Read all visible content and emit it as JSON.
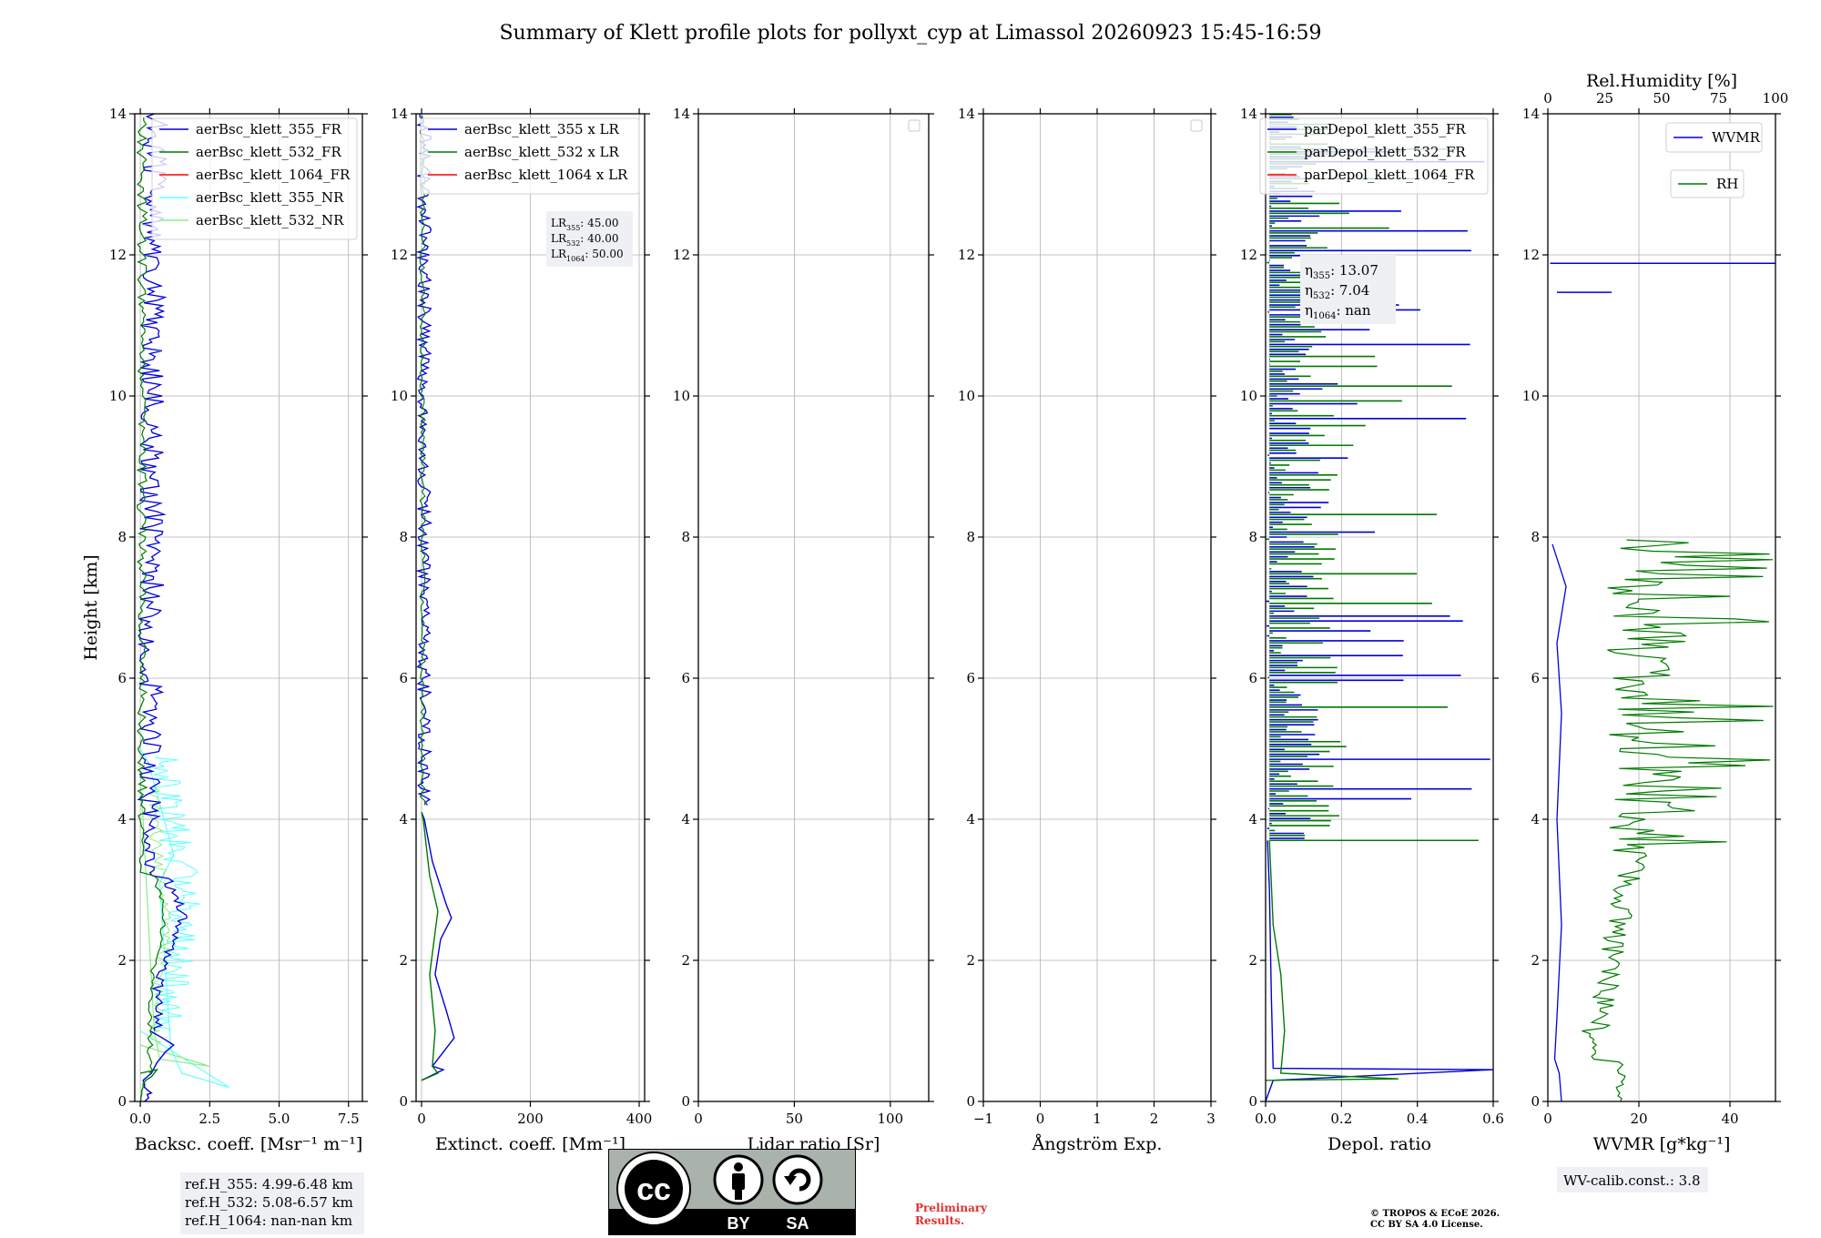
{
  "title": "Summary of Klett profile plots for pollyxt_cyp at Limassol 20260923 15:45-16:59",
  "colors": {
    "b355": "#0000dd",
    "g532": "#007a00",
    "r1064": "#ff0000",
    "c355nr": "#66ffff",
    "lg532nr": "#88ee88",
    "grid": "#b0b0b0"
  },
  "chart_data": [
    {
      "type": "line",
      "id": "bsc",
      "xlabel": "Backsc. coeff. [Msr⁻¹ m⁻¹]",
      "ylabel": "Height [km]",
      "xlim": [
        -0.2,
        8.0
      ],
      "ylim": [
        0,
        14
      ],
      "xticks": [
        0,
        2.5,
        5.0,
        7.5
      ],
      "xtick_labels": [
        "0.0",
        "2.5",
        "5.0",
        "7.5"
      ],
      "yticks": [
        0,
        2,
        4,
        6,
        8,
        10,
        12,
        14
      ],
      "grid": true,
      "legend_position": "top-right",
      "series": [
        {
          "name": "aerBsc_klett_355_FR",
          "color": "b355",
          "profile": [
            [
              0.35,
              1.0
            ],
            [
              0.8,
              0.9
            ],
            [
              1.2,
              0.8
            ],
            [
              0.9,
              0.7
            ],
            [
              0.6,
              0.55
            ],
            [
              0.4,
              0.4
            ],
            [
              0.25,
              0.35
            ],
            [
              0.1,
              0.3
            ],
            [
              0.15,
              0.25
            ],
            [
              0.15,
              0.2
            ],
            [
              0.3,
              0.15
            ],
            [
              0.4,
              0.12
            ],
            [
              0.25,
              0.1
            ],
            [
              0.3,
              0.05
            ],
            [
              0.15,
              0.0
            ]
          ]
        },
        {
          "name": "aerBsc_klett_532_FR",
          "color": "g532",
          "profile": [
            [
              0.0,
              0.4
            ],
            [
              0.6,
              0.45
            ],
            [
              0.4,
              0.35
            ],
            [
              0.2,
              0.3
            ],
            [
              0.1,
              0.25
            ],
            [
              0.1,
              0.2
            ],
            [
              0.05,
              0.15
            ],
            [
              0.05,
              0.1
            ],
            [
              0.02,
              0.05
            ],
            [
              0.02,
              0.0
            ]
          ]
        },
        {
          "name": "aerBsc_klett_1064_FR",
          "color": "r1064",
          "profile": []
        },
        {
          "name": "aerBsc_klett_355_NR",
          "color": "c355nr",
          "profile": [
            [
              0.0,
              1.0
            ],
            [
              3.2,
              0.2
            ],
            [
              1.5,
              0.4
            ],
            [
              1.1,
              0.75
            ],
            [
              0.7,
              3.1
            ],
            [
              1.2,
              3.5
            ],
            [
              0.3,
              4.8
            ],
            [
              0.0,
              5.0
            ]
          ]
        },
        {
          "name": "aerBsc_klett_532_NR",
          "color": "lg532nr",
          "profile": [
            [
              0.0,
              0.8
            ],
            [
              2.5,
              0.5
            ],
            [
              0.7,
              0.6
            ],
            [
              0.5,
              1.0
            ],
            [
              0.3,
              2.5
            ],
            [
              0.1,
              4.0
            ],
            [
              0.0,
              4.5
            ]
          ]
        }
      ],
      "annotation": [
        "ref.H_355: 4.99-6.48 km",
        "ref.H_532: 5.08-6.57 km",
        "ref.H_1064: nan-nan km"
      ]
    },
    {
      "type": "line",
      "id": "ext",
      "xlabel": "Extinct. coeff. [Mm⁻¹]",
      "xlim": [
        -10,
        410
      ],
      "ylim": [
        0,
        14
      ],
      "xticks": [
        0,
        200,
        400
      ],
      "xtick_labels": [
        "0",
        "200",
        "400"
      ],
      "yticks": [
        0,
        2,
        4,
        6,
        8,
        10,
        12,
        14
      ],
      "grid": true,
      "legend_position": "top-right",
      "series": [
        {
          "name": "aerBsc_klett_355 x LR",
          "color": "b355"
        },
        {
          "name": "aerBsc_klett_532 x LR",
          "color": "g532"
        },
        {
          "name": "aerBsc_klett_1064 x LR",
          "color": "r1064"
        }
      ],
      "annotation": [
        {
          "sym": "LR",
          "sub": "355",
          "val": ": 45.00"
        },
        {
          "sym": "LR",
          "sub": "532",
          "val": ": 40.00"
        },
        {
          "sym": "LR",
          "sub": "1064",
          "val": ": 50.00"
        }
      ]
    },
    {
      "type": "line",
      "id": "lr",
      "xlabel": "Lidar ratio [Sr]",
      "xlim": [
        0,
        120
      ],
      "ylim": [
        0,
        14
      ],
      "xticks": [
        0,
        50,
        100
      ],
      "xtick_labels": [
        "0",
        "50",
        "100"
      ],
      "yticks": [
        0,
        2,
        4,
        6,
        8,
        10,
        12,
        14
      ],
      "grid": true,
      "legend_position": "top-right",
      "series": []
    },
    {
      "type": "line",
      "id": "ae",
      "xlabel": "Ångström Exp.",
      "xlim": [
        -1,
        3
      ],
      "ylim": [
        0,
        14
      ],
      "xticks": [
        -1,
        0,
        1,
        2,
        3
      ],
      "xtick_labels": [
        "−1",
        "0",
        "1",
        "2",
        "3"
      ],
      "yticks": [
        0,
        2,
        4,
        6,
        8,
        10,
        12,
        14
      ],
      "grid": true,
      "legend_position": "top-right",
      "series": []
    },
    {
      "type": "line",
      "id": "dep",
      "xlabel": "Depol. ratio",
      "xlim": [
        0,
        0.6
      ],
      "ylim": [
        0,
        14
      ],
      "xticks": [
        0,
        0.2,
        0.4,
        0.6
      ],
      "xtick_labels": [
        "0.0",
        "0.2",
        "0.4",
        "0.6"
      ],
      "yticks": [
        0,
        2,
        4,
        6,
        8,
        10,
        12,
        14
      ],
      "grid": true,
      "legend_position": "top-right",
      "series": [
        {
          "name": "parDepol_klett_355_FR",
          "color": "b355"
        },
        {
          "name": "parDepol_klett_532_FR",
          "color": "g532"
        },
        {
          "name": "parDepol_klett_1064_FR",
          "color": "r1064"
        }
      ],
      "annotation": [
        {
          "sym": "η",
          "sub": "355",
          "val": ": 13.07"
        },
        {
          "sym": "η",
          "sub": "532",
          "val": ": 7.04"
        },
        {
          "sym": "η",
          "sub": "1064",
          "val": ": nan"
        }
      ]
    },
    {
      "type": "line",
      "id": "wv",
      "xlabel": "WVMR [g*kg⁻¹]",
      "xlabel_top": "Rel.Humidity [%]",
      "xlim": [
        0,
        50
      ],
      "ylim": [
        0,
        14
      ],
      "xticks": [
        0,
        20,
        40
      ],
      "xtick_labels": [
        "0",
        "20",
        "40"
      ],
      "xlim_top": [
        0,
        100
      ],
      "xticks_top": [
        0,
        25,
        50,
        75,
        100
      ],
      "xtick_labels_top": [
        "0",
        "25",
        "50",
        "75",
        "100"
      ],
      "yticks": [
        0,
        2,
        4,
        6,
        8,
        10,
        12,
        14
      ],
      "grid": true,
      "series": [
        {
          "name": "WVMR",
          "color": "b355"
        },
        {
          "name": "RH",
          "color": "g532"
        }
      ],
      "annotation": [
        "WV-calib.const.: 3.8"
      ]
    }
  ],
  "credits": {
    "license_badge": [
      "BY",
      "SA"
    ],
    "preliminary": "Preliminary\nResults.",
    "copyright": "© TROPOS & ECoE 2026.\nCC BY SA 4.0 License."
  }
}
